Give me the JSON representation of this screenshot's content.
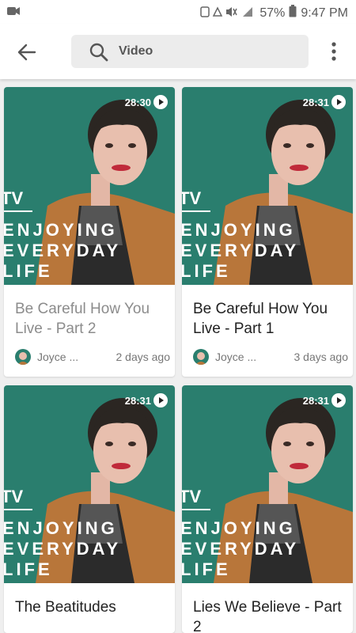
{
  "status": {
    "battery": "57%",
    "time": "9:47 PM",
    "network": "4G"
  },
  "search": {
    "query": "Video"
  },
  "thumbnail_brand": {
    "tv": "TV",
    "line1": "ENJOYING",
    "line2": "EVERYDAY",
    "line3": "LIFE"
  },
  "videos": [
    {
      "duration": "28:30",
      "title": "Be Careful How You Live - Part 2",
      "author": "Joyce ...",
      "age": "2 days ago",
      "watched": true
    },
    {
      "duration": "28:31",
      "title": "Be Careful How You Live - Part 1",
      "author": "Joyce ...",
      "age": "3 days ago",
      "watched": false
    },
    {
      "duration": "28:31",
      "title": "The Beatitudes",
      "author": "",
      "age": "",
      "watched": false
    },
    {
      "duration": "28:31",
      "title": "Lies We Believe - Part 2",
      "author": "",
      "age": "",
      "watched": false
    }
  ],
  "colors": {
    "thumbnail_bg": "#2a7e6e",
    "jacket": "#b8763a"
  }
}
